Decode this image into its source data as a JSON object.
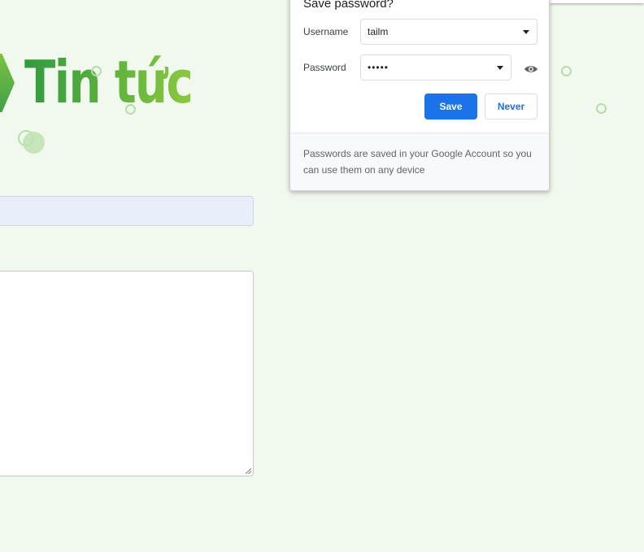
{
  "page": {
    "title": "Tin tức",
    "brand_colors": {
      "green_dark": "#339a3f",
      "green_light": "#8cc83f",
      "background": "#f1f8ee"
    }
  },
  "form": {
    "subject_value": "",
    "message_value": ""
  },
  "password_dialog": {
    "title": "Save password?",
    "username_label": "Username",
    "username_value": "tailm",
    "password_label": "Password",
    "password_value": "•••••",
    "save_label": "Save",
    "never_label": "Never",
    "footer_text": "Passwords are saved in your Google Account so you can use them on any device",
    "accent_color": "#1a73e8",
    "icons": {
      "dropdown": "caret-down-icon",
      "reveal": "eye-icon"
    }
  }
}
